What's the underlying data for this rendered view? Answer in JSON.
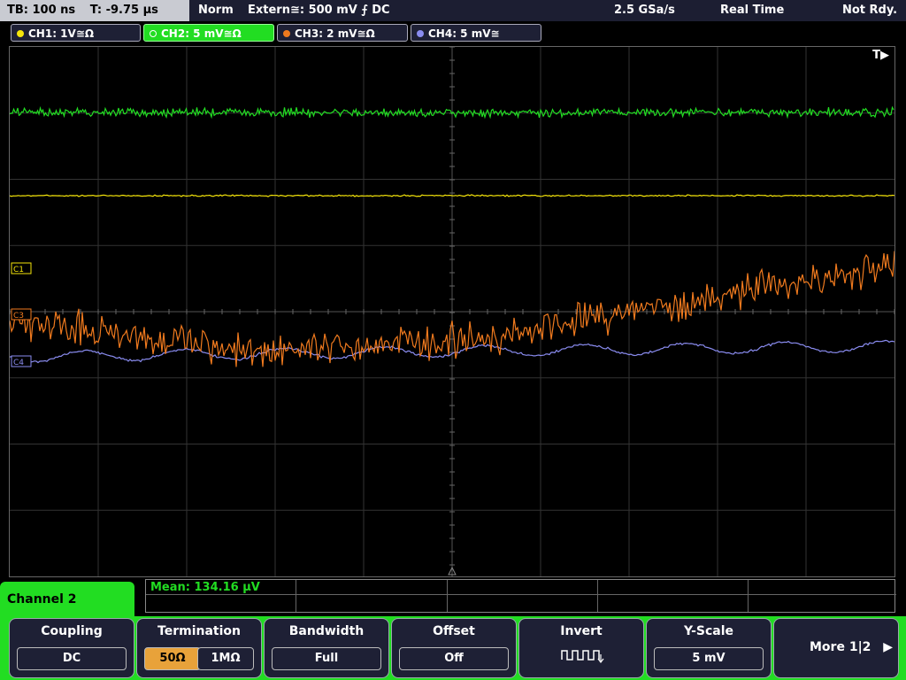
{
  "topbar": {
    "timebase": "TB: 100 ns",
    "trigger_time": "T: -9.75 µs",
    "mode": "Norm",
    "trigger_source": "Extern≅: 500 mV ⨍ DC",
    "sample_rate": "2.5 GSa/s",
    "acq_mode": "Real Time",
    "status": "Not Rdy."
  },
  "channels": [
    {
      "label": "CH1: 1V≅Ω",
      "color": "#f5e50a"
    },
    {
      "label": "CH2: 5 mV≅Ω",
      "color": "#22dd22"
    },
    {
      "label": "CH3: 2 mV≅Ω",
      "color": "#f07a1e"
    },
    {
      "label": "CH4: 5 mV≅",
      "color": "#8a8cf0"
    }
  ],
  "plot": {
    "trigger_marker": "T▶",
    "markers": [
      "C1",
      "C3",
      "C4"
    ]
  },
  "panel": {
    "title": "Channel 2",
    "measurement": "Mean: 134.16 µV"
  },
  "softkeys": {
    "coupling": {
      "title": "Coupling",
      "value": "DC"
    },
    "termination": {
      "title": "Termination",
      "opt1": "50Ω",
      "opt2": "1MΩ"
    },
    "bandwidth": {
      "title": "Bandwidth",
      "value": "Full"
    },
    "offset": {
      "title": "Offset",
      "value": "Off"
    },
    "invert": {
      "title": "Invert"
    },
    "yscale": {
      "title": "Y-Scale",
      "value": "5 mV"
    },
    "more": {
      "label": "More 1|2",
      "arrow": "▶"
    }
  }
}
